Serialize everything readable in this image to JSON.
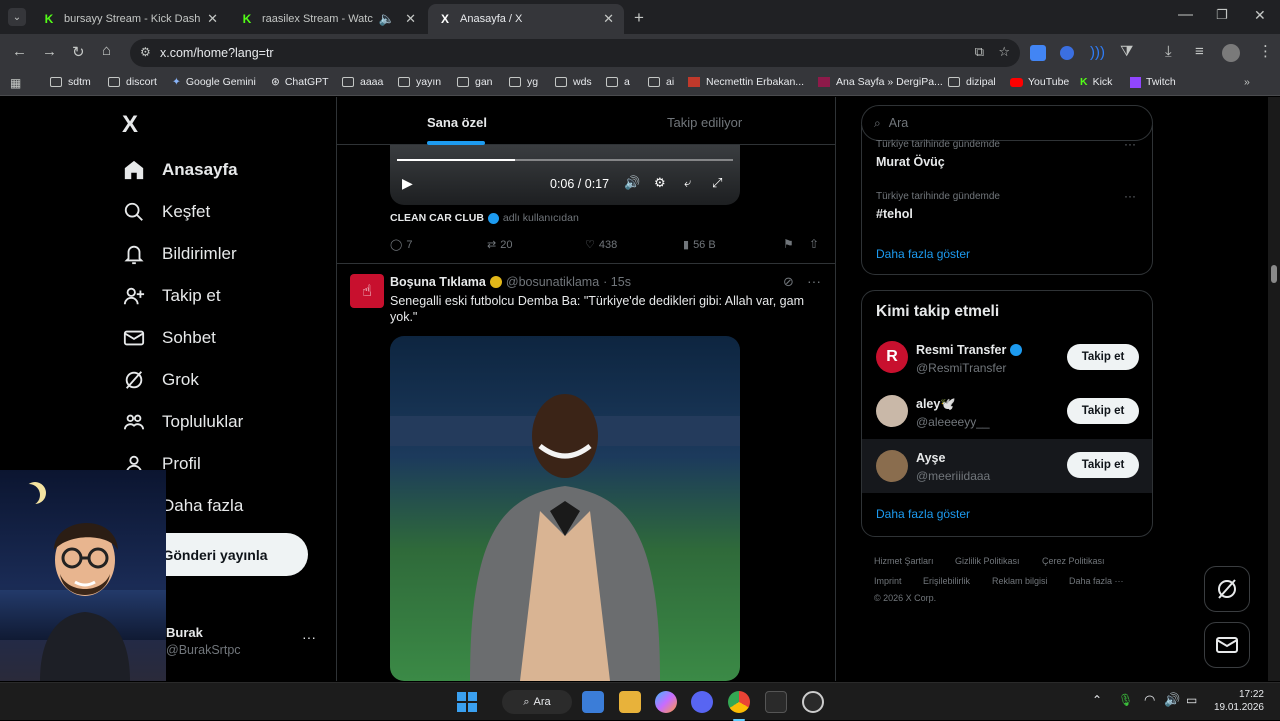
{
  "browser": {
    "tabs": [
      {
        "title": "bursayy Stream - Kick Dashboard",
        "favicon": "K"
      },
      {
        "title": "raasilex Stream - Watch Live",
        "favicon": "K"
      },
      {
        "title": "Anasayfa / X",
        "favicon": "X"
      }
    ],
    "address": "x.com/home?lang=tr",
    "bookmarks": [
      "sdtm",
      "discort",
      "Google Gemini",
      "ChatGPT",
      "aaaa",
      "yayın",
      "gan",
      "yg",
      "wds",
      "a",
      "ai",
      "Necmettin Erbakan...",
      "Ana Sayfa » DergiPa...",
      "dizipal",
      "YouTube",
      "Kick",
      "Twitch"
    ]
  },
  "sidebar": {
    "logo": "X",
    "items": [
      {
        "label": "Anasayfa",
        "icon": "home-icon"
      },
      {
        "label": "Keşfet",
        "icon": "search-icon"
      },
      {
        "label": "Bildirimler",
        "icon": "bell-icon"
      },
      {
        "label": "Takip et",
        "icon": "add-user-icon"
      },
      {
        "label": "Sohbet",
        "icon": "mail-icon"
      },
      {
        "label": "Grok",
        "icon": "grok-icon"
      },
      {
        "label": "Topluluklar",
        "icon": "communities-icon"
      },
      {
        "label": "Profil",
        "icon": "profile-icon"
      },
      {
        "label": "Daha fazla",
        "icon": "more-icon"
      }
    ],
    "post_button": "Gönderi yayınla",
    "account": {
      "name": "Burak",
      "handle": "@BurakSrtpc",
      "menu": "···"
    }
  },
  "feed": {
    "tabs": [
      "Sana özel",
      "Takip ediliyor"
    ],
    "video": {
      "time": "0:06 / 0:17",
      "progress": 0.35
    },
    "prev_tweet": {
      "source": "CLEAN CAR CLUB",
      "source_suffix": "adlı kullanıcıdan",
      "replies": "7",
      "reposts": "20",
      "likes": "438",
      "views": "56 B"
    },
    "tweet": {
      "name": "Boşuna Tıklama",
      "handle": "@bosunatiklama",
      "time": "· 15s",
      "text": "Senegalli eski futbolcu Demba Ba: \"Türkiye'de dedikleri gibi: Allah var, gam yok.\""
    }
  },
  "right": {
    "search_placeholder": "Ara",
    "trends": [
      {
        "context": "Türkiye tarihinde gündemde",
        "name": "Murat Övüç"
      },
      {
        "context": "Türkiye tarihinde gündemde",
        "name": "#tehol"
      }
    ],
    "show_more": "Daha fazla göster",
    "who_to_follow": {
      "title": "Kimi takip etmeli",
      "users": [
        {
          "name": "Resmi Transfer",
          "handle": "@ResmiTransfer",
          "verified": true
        },
        {
          "name": "aley🕊️",
          "handle": "@aleeeeyy__",
          "verified": false
        },
        {
          "name": "Ayşe",
          "handle": "@meeriiidaaa",
          "verified": false
        }
      ],
      "follow_label": "Takip et",
      "show_more": "Daha fazla göster"
    },
    "footer": {
      "line1": [
        "Hizmet Şartları",
        "Gizlilik Politikası",
        "Çerez Politikası"
      ],
      "line2": [
        "Imprint",
        "Erişilebilirlik",
        "Reklam bilgisi",
        "Daha fazla ···"
      ],
      "copyright": "© 2026 X Corp."
    }
  },
  "taskbar": {
    "search": "Ara",
    "time": "17:22",
    "date": "19.01.2026"
  },
  "colors": {
    "accent": "#1d9bf0",
    "bg": "#000000",
    "border": "#2f3336"
  }
}
